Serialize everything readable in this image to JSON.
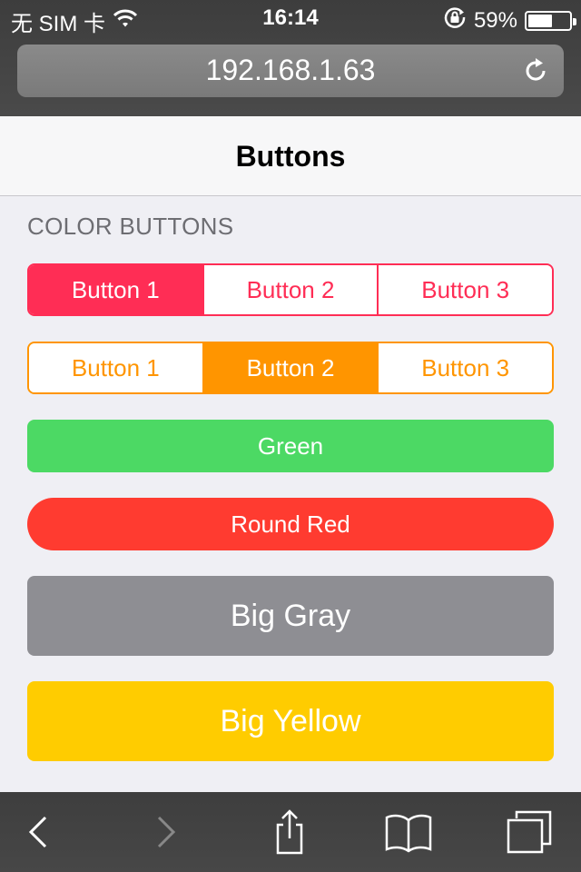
{
  "status_bar": {
    "carrier": "无 SIM 卡",
    "time": "16:14",
    "battery_percent_text": "59%",
    "battery_level": 0.59
  },
  "browser": {
    "url": "192.168.1.63"
  },
  "navbar": {
    "title": "Buttons"
  },
  "content": {
    "section_title": "COLOR BUTTONS",
    "pink_segmented": [
      "Button 1",
      "Button 2",
      "Button 3"
    ],
    "orange_segmented": [
      "Button 1",
      "Button 2",
      "Button 3"
    ],
    "green_button": "Green",
    "round_red_button": "Round Red",
    "big_gray_button": "Big Gray",
    "big_yellow_button": "Big Yellow"
  },
  "toolbar": {
    "icons": [
      "back-icon",
      "forward-icon",
      "share-icon",
      "bookmarks-icon",
      "tabs-icon"
    ]
  },
  "colors": {
    "pink": "#ff2d55",
    "orange": "#ff9500",
    "green": "#4cd964",
    "red": "#ff3b30",
    "gray": "#8e8e93",
    "yellow": "#ffcc00"
  }
}
